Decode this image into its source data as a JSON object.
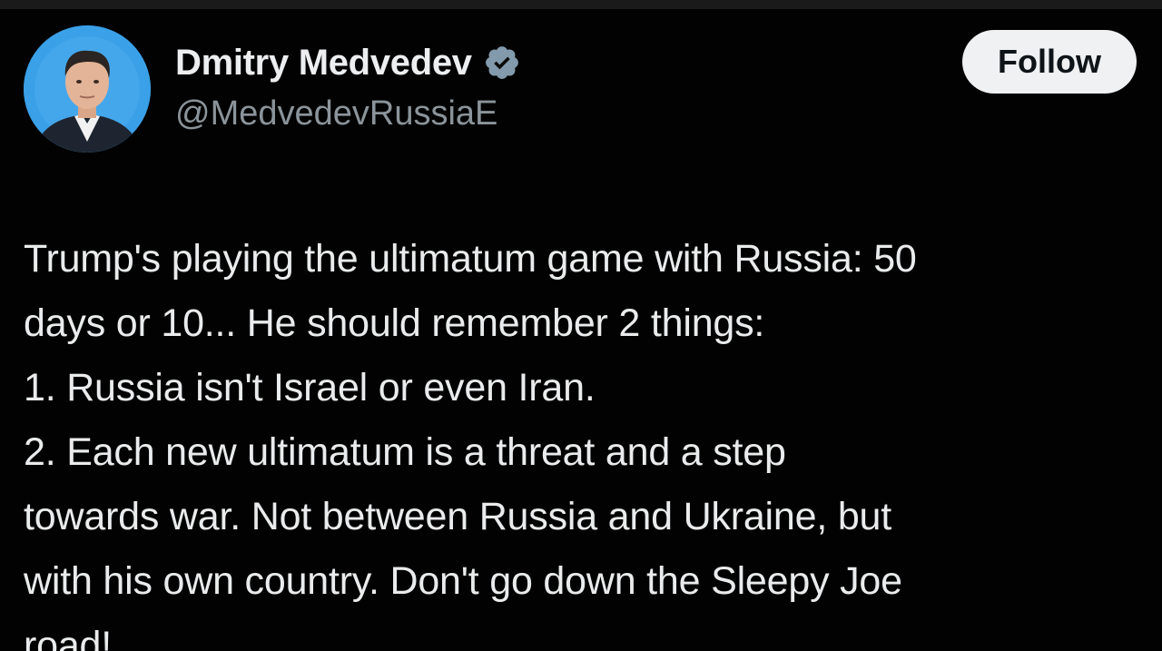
{
  "author": {
    "display_name": "Dmitry Medvedev",
    "handle": "@MedvedevRussiaE",
    "verified": true,
    "avatar_icon": "profile-photo"
  },
  "actions": {
    "follow_label": "Follow"
  },
  "tweet": {
    "lines": [
      "Trump's playing the ultimatum game with Russia: 50",
      "days or 10... He should remember 2 things:",
      "1. Russia isn't Israel or even Iran.",
      "2. Each new ultimatum is a threat and a step",
      "towards war. Not between Russia and Ukraine, but",
      "with his own country. Don't go down the Sleepy Joe",
      "road!"
    ]
  },
  "colors": {
    "background": "#020202",
    "text_primary": "#e9ebec",
    "text_secondary": "#8b949a",
    "verified_badge": "#829aab",
    "follow_button_bg": "#eff1f3",
    "avatar_bg": "#3aa0e8"
  }
}
